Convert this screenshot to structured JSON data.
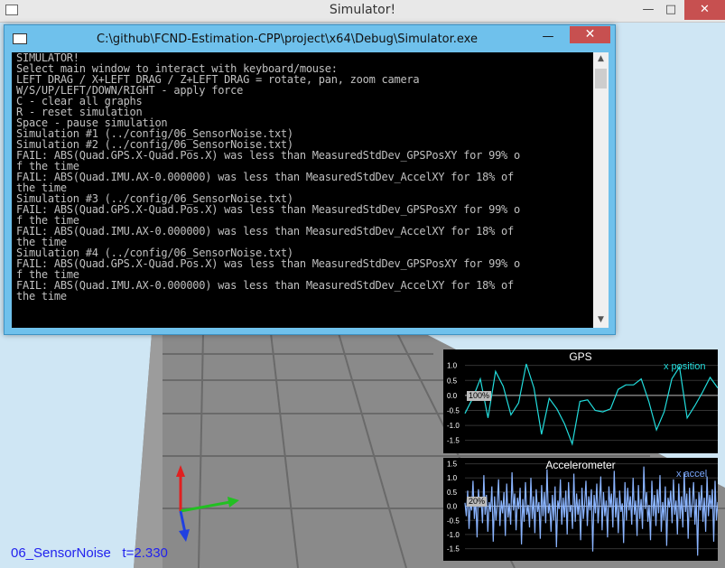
{
  "window": {
    "title": "Simulator!",
    "min": "—",
    "max": "□",
    "close": "✕"
  },
  "console": {
    "title": "C:\\github\\FCND-Estimation-CPP\\project\\x64\\Debug\\Simulator.exe",
    "min": "—",
    "max": "□",
    "close": "✕",
    "lines": [
      "SIMULATOR!",
      "Select main window to interact with keyboard/mouse:",
      "LEFT DRAG / X+LEFT DRAG / Z+LEFT DRAG = rotate, pan, zoom camera",
      "W/S/UP/LEFT/DOWN/RIGHT - apply force",
      "C - clear all graphs",
      "R - reset simulation",
      "Space - pause simulation",
      "Simulation #1 (../config/06_SensorNoise.txt)",
      "Simulation #2 (../config/06_SensorNoise.txt)",
      "FAIL: ABS(Quad.GPS.X-Quad.Pos.X) was less than MeasuredStdDev_GPSPosXY for 99% o",
      "f the time",
      "FAIL: ABS(Quad.IMU.AX-0.000000) was less than MeasuredStdDev_AccelXY for 18% of",
      "the time",
      "Simulation #3 (../config/06_SensorNoise.txt)",
      "FAIL: ABS(Quad.GPS.X-Quad.Pos.X) was less than MeasuredStdDev_GPSPosXY for 99% o",
      "f the time",
      "FAIL: ABS(Quad.IMU.AX-0.000000) was less than MeasuredStdDev_AccelXY for 18% of",
      "the time",
      "Simulation #4 (../config/06_SensorNoise.txt)",
      "FAIL: ABS(Quad.GPS.X-Quad.Pos.X) was less than MeasuredStdDev_GPSPosXY for 99% o",
      "f the time",
      "FAIL: ABS(Quad.IMU.AX-0.000000) was less than MeasuredStdDev_AccelXY for 18% of",
      "the time"
    ]
  },
  "status": {
    "scenario": "06_SensorNoise",
    "time": "t=2.330"
  },
  "colors": {
    "status_text": "#2222ee",
    "gps_series": "#22dddd",
    "accel_series": "#8ab4ff",
    "legend_accel": "#7aa8ff",
    "close_button": "#c75050"
  },
  "graphs": {
    "gps": {
      "title": "GPS",
      "legend": "x position",
      "percent": "100%",
      "y_ticks": [
        "1.0",
        "0.5",
        "0.0",
        "-0.5",
        "-1.0",
        "-1.5"
      ],
      "ylim": [
        -1.6,
        1.2
      ],
      "values": [
        -0.6,
        -0.1,
        0.55,
        -0.75,
        0.8,
        0.3,
        -0.65,
        -0.25,
        1.05,
        0.25,
        -1.3,
        -0.1,
        -0.45,
        -0.95,
        -1.62,
        -0.2,
        -0.15,
        -0.5,
        -0.55,
        -0.45,
        0.2,
        0.35,
        0.35,
        0.55,
        -0.2,
        -1.15,
        -0.55,
        0.55,
        0.95,
        -0.75,
        -0.35,
        0.1,
        0.6,
        0.25
      ]
    },
    "accelerometer": {
      "title": "Accelerometer",
      "legend": "x accel",
      "percent": "20%",
      "y_ticks": [
        "1.5",
        "1.0",
        "0.5",
        "0.0",
        "-0.5",
        "-1.0",
        "-1.5"
      ],
      "ylim": [
        -1.8,
        1.55
      ],
      "values": [
        0.12,
        -0.35,
        0.55,
        -0.8,
        0.2,
        -0.15,
        0.9,
        -0.45,
        0.3,
        -1.1,
        0.6,
        -0.05,
        0.25,
        -0.6,
        1.1,
        -0.3,
        0.4,
        -0.9,
        0.15,
        -0.2,
        0.7,
        -1.25,
        0.35,
        -0.5,
        0.05,
        0.95,
        -0.7,
        0.2,
        -0.25,
        0.5,
        -1.05,
        0.8,
        -0.4,
        0.1,
        -0.65,
        1.2,
        -0.15,
        0.45,
        -0.85,
        0.3,
        -0.1,
        0.65,
        -1.35,
        0.25,
        -0.55,
        0.85,
        -0.3,
        0.05,
        -0.75,
        1.0,
        -0.45,
        0.35,
        -0.95,
        0.6,
        -0.2,
        0.15,
        -1.15,
        0.75,
        -0.35,
        0.5,
        -0.6,
        1.3,
        -0.25,
        0.1,
        -0.9,
        0.4,
        -0.5,
        0.7,
        -1.45,
        0.2,
        -0.1,
        0.95,
        -0.65,
        0.3,
        -0.4,
        0.55,
        -1.0,
        0.85,
        -0.2,
        0.05,
        -0.8,
        1.15,
        -0.55,
        0.45,
        -0.3,
        0.25,
        -1.2,
        0.65,
        -0.45,
        0.1,
        0.9,
        -0.7,
        0.35,
        -0.15,
        0.6,
        -1.6,
        0.4,
        -0.25,
        0.8,
        -0.6,
        0.15,
        1.05,
        -0.85,
        0.5,
        -0.35,
        0.2,
        -1.1,
        0.7,
        -0.05,
        0.45,
        -0.75,
        1.25,
        -0.4,
        0.3,
        -0.95,
        0.55,
        -0.2,
        0.1,
        -1.3,
        0.85,
        -0.5,
        0.65,
        -0.15,
        0.35,
        -0.65,
        1.0,
        -0.3,
        0.2,
        -1.05,
        0.75,
        -0.45,
        0.25,
        -0.8,
        1.4,
        -0.1,
        0.5,
        -0.55,
        0.05,
        -1.2,
        0.9,
        -0.35,
        0.4,
        -0.7,
        0.6,
        -0.25,
        1.1,
        -0.9,
        0.15,
        -0.5,
        0.7,
        -1.4,
        0.3,
        -0.05,
        0.55,
        -0.6,
        0.95,
        -0.3,
        0.2,
        -1.0,
        0.8,
        -0.45,
        0.35,
        -0.75,
        1.2,
        -0.2,
        0.45,
        -1.15,
        0.65,
        -0.4,
        0.1,
        0.85,
        -0.65,
        0.25,
        -1.75,
        0.5,
        -0.15,
        0.75,
        -0.55,
        0.3,
        -0.9,
        1.05,
        -0.35,
        0.4,
        -0.1,
        0.6,
        -1.25,
        0.9,
        -0.5,
        0.15
      ]
    }
  }
}
